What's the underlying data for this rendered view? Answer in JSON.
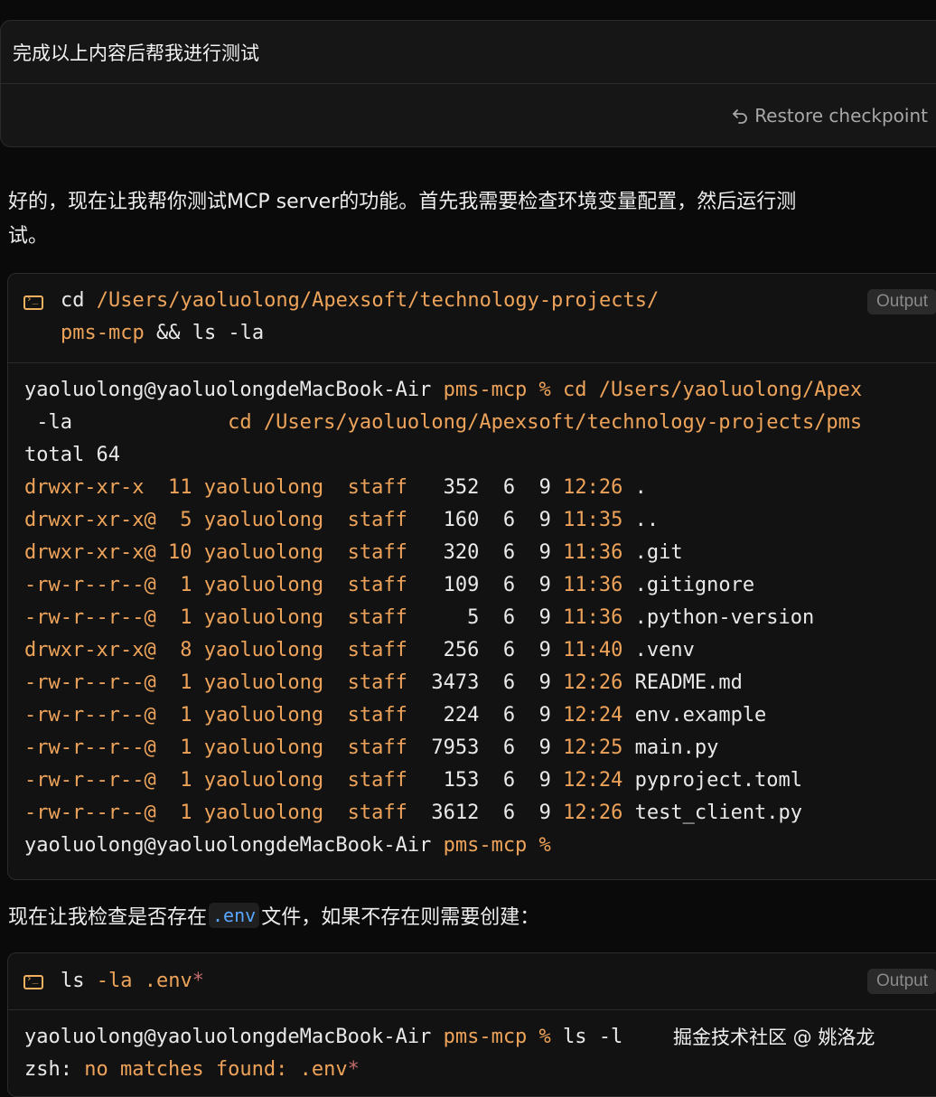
{
  "user_message": {
    "text": "完成以上内容后帮我进行测试",
    "restore_label": "Restore checkpoint"
  },
  "assistant": {
    "paragraph1_line1": "好的，现在让我帮你测试MCP server的功能。首先我需要检查环境变量配置，然后运行测",
    "paragraph1_line2": "试。",
    "paragraph2_before": "现在让我检查是否存在",
    "paragraph2_code": ".env",
    "paragraph2_after": "文件，如果不存在则需要创建："
  },
  "terminal1": {
    "command_line1_cmd": "cd",
    "command_line1_path": " /Users/yaoluolong/Apexsoft/technology-projects/",
    "command_line2_path": "pms-mcp",
    "command_line2_rest": " && ls -la",
    "output_label": "Output",
    "prompt_user": "yaoluolong@yaoluolongdeMacBook-Air",
    "prompt_dir": " pms-mcp % ",
    "prompt_cmd": "cd /Users/yaoluolong/Apex",
    "wrap_line_a": " -la",
    "wrap_line_b": "cd /Users/yaoluolong/Apexsoft/technology-projects/pms",
    "total": "total 64",
    "files": [
      {
        "perm": "drwxr-xr-x ",
        "links": "11",
        "owner": "yaoluolong",
        "group": "staff",
        "size": "  352",
        "month": "6",
        "day": "9",
        "time": "12:26",
        "name": "."
      },
      {
        "perm": "drwxr-xr-x@",
        "links": " 5",
        "owner": "yaoluolong",
        "group": "staff",
        "size": "  160",
        "month": "6",
        "day": "9",
        "time": "11:35",
        "name": ".."
      },
      {
        "perm": "drwxr-xr-x@",
        "links": "10",
        "owner": "yaoluolong",
        "group": "staff",
        "size": "  320",
        "month": "6",
        "day": "9",
        "time": "11:36",
        "name": ".git"
      },
      {
        "perm": "-rw-r--r--@",
        "links": " 1",
        "owner": "yaoluolong",
        "group": "staff",
        "size": "  109",
        "month": "6",
        "day": "9",
        "time": "11:36",
        "name": ".gitignore"
      },
      {
        "perm": "-rw-r--r--@",
        "links": " 1",
        "owner": "yaoluolong",
        "group": "staff",
        "size": "    5",
        "month": "6",
        "day": "9",
        "time": "11:36",
        "name": ".python-version"
      },
      {
        "perm": "drwxr-xr-x@",
        "links": " 8",
        "owner": "yaoluolong",
        "group": "staff",
        "size": "  256",
        "month": "6",
        "day": "9",
        "time": "11:40",
        "name": ".venv"
      },
      {
        "perm": "-rw-r--r--@",
        "links": " 1",
        "owner": "yaoluolong",
        "group": "staff",
        "size": " 3473",
        "month": "6",
        "day": "9",
        "time": "12:26",
        "name": "README.md"
      },
      {
        "perm": "-rw-r--r--@",
        "links": " 1",
        "owner": "yaoluolong",
        "group": "staff",
        "size": "  224",
        "month": "6",
        "day": "9",
        "time": "12:24",
        "name": "env.example"
      },
      {
        "perm": "-rw-r--r--@",
        "links": " 1",
        "owner": "yaoluolong",
        "group": "staff",
        "size": " 7953",
        "month": "6",
        "day": "9",
        "time": "12:25",
        "name": "main.py"
      },
      {
        "perm": "-rw-r--r--@",
        "links": " 1",
        "owner": "yaoluolong",
        "group": "staff",
        "size": "  153",
        "month": "6",
        "day": "9",
        "time": "12:24",
        "name": "pyproject.toml"
      },
      {
        "perm": "-rw-r--r--@",
        "links": " 1",
        "owner": "yaoluolong",
        "group": "staff",
        "size": " 3612",
        "month": "6",
        "day": "9",
        "time": "12:26",
        "name": "test_client.py"
      }
    ],
    "final_prompt_user": "yaoluolong@yaoluolongdeMacBook-Air",
    "final_prompt_dir": " pms-mcp %"
  },
  "terminal2": {
    "command_cmd": "ls",
    "command_rest": " -la .env",
    "command_star": "*",
    "output_label": "Output",
    "prompt_user": "yaoluolong@yaoluolongdeMacBook-Air",
    "prompt_dir": " pms-mcp % ",
    "prompt_cmd": "ls -l",
    "error_prefix": "zsh:",
    "error_msg": " no matches found: .env",
    "error_star": "*"
  },
  "watermark": "掘金技术社区 @ 姚洛龙",
  "colors": {
    "accent_orange": "#eea35a",
    "inline_code_blue": "#58a6ff",
    "background": "#0a0a0a"
  },
  "icons": {
    "restore": "undo-arrow-icon",
    "terminal": "terminal-icon"
  }
}
